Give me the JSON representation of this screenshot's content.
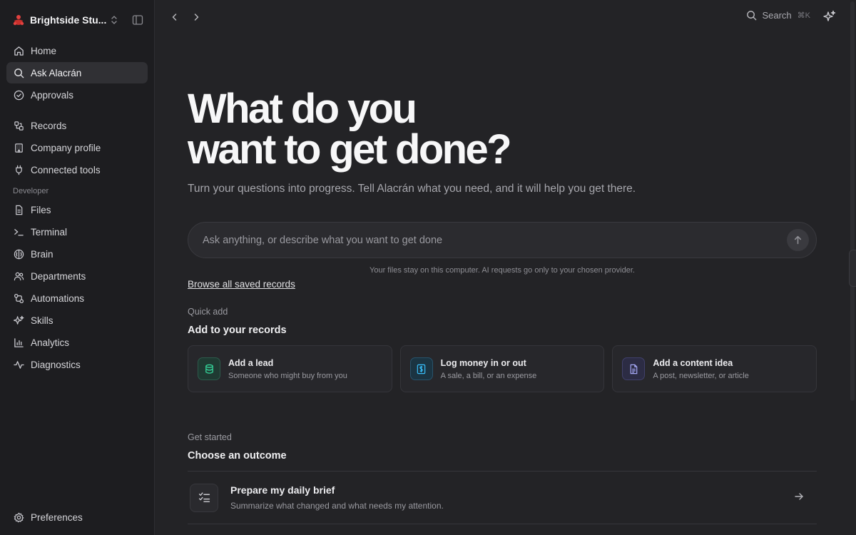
{
  "workspace": {
    "name": "Brightside Stu..."
  },
  "sidebar": {
    "items": [
      {
        "label": "Home",
        "icon": "home-icon"
      },
      {
        "label": "Ask Alacrán",
        "icon": "search-icon",
        "active": true
      },
      {
        "label": "Approvals",
        "icon": "check-circle-icon"
      },
      {
        "label": "Records",
        "icon": "records-icon"
      },
      {
        "label": "Company profile",
        "icon": "building-icon"
      },
      {
        "label": "Connected tools",
        "icon": "plug-icon"
      }
    ],
    "developer_section": "Developer",
    "developer_items": [
      {
        "label": "Files",
        "icon": "file-icon"
      },
      {
        "label": "Terminal",
        "icon": "terminal-icon"
      },
      {
        "label": "Brain",
        "icon": "brain-icon"
      },
      {
        "label": "Departments",
        "icon": "users-icon"
      },
      {
        "label": "Automations",
        "icon": "workflow-icon"
      },
      {
        "label": "Skills",
        "icon": "sparkles-icon"
      },
      {
        "label": "Analytics",
        "icon": "bar-chart-icon"
      },
      {
        "label": "Diagnostics",
        "icon": "activity-icon"
      }
    ],
    "footer": {
      "label": "Preferences",
      "icon": "gear-icon"
    }
  },
  "topbar": {
    "search_label": "Search",
    "search_shortcut": "⌘K"
  },
  "hero": {
    "title_line1": "What do you",
    "title_line2": "want to get done?",
    "subtitle": "Turn your questions into progress. Tell Alacrán what you need, and it will help you get there."
  },
  "ask": {
    "placeholder": "Ask anything, or describe what you want to get done",
    "privacy_note": "Your files stay on this computer. AI requests go only to your chosen provider."
  },
  "browse_link": "Browse all saved records",
  "quick_add": {
    "kicker": "Quick add",
    "title": "Add to your records",
    "cards": [
      {
        "title": "Add a lead",
        "desc": "Someone who might buy from you",
        "icon": "database-icon",
        "color": "#34d399"
      },
      {
        "title": "Log money in or out",
        "desc": "A sale, a bill, or an expense",
        "icon": "dollar-icon",
        "color": "#38bdf8"
      },
      {
        "title": "Add a content idea",
        "desc": "A post, newsletter, or article",
        "icon": "document-icon",
        "color": "#a5a8f5"
      }
    ]
  },
  "get_started": {
    "kicker": "Get started",
    "title": "Choose an outcome",
    "outcomes": [
      {
        "title": "Prepare my daily brief",
        "desc": "Summarize what changed and what needs my attention.",
        "icon": "checklist-icon"
      }
    ]
  }
}
